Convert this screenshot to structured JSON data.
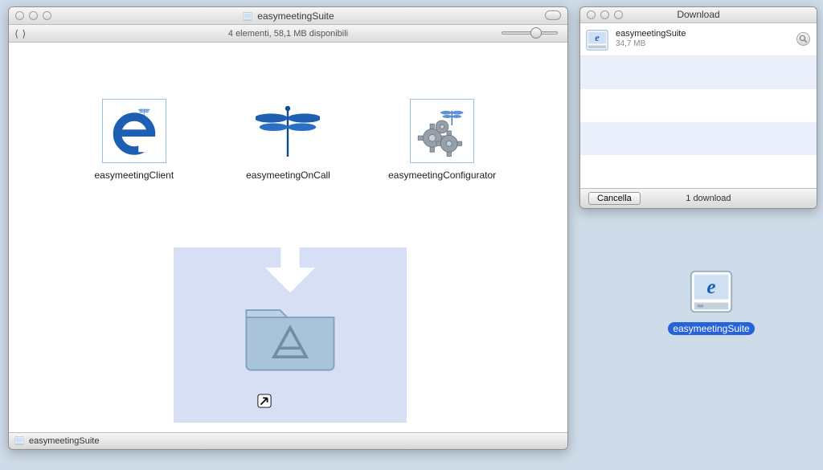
{
  "finder": {
    "title": "easymeetingSuite",
    "status": "4 elementi, 58,1 MB disponibili",
    "footer": "easymeetingSuite",
    "apps": [
      {
        "label": "easymeetingClient"
      },
      {
        "label": "easymeetingOnCall"
      },
      {
        "label": "easymeetingConfigurator"
      }
    ]
  },
  "download": {
    "title": "Download",
    "item_name": "easymeetingSuite",
    "item_size": "34,7 MB",
    "clear_button": "Cancella",
    "count_label": "1 download"
  },
  "desktop": {
    "label": "easymeetingSuite"
  }
}
